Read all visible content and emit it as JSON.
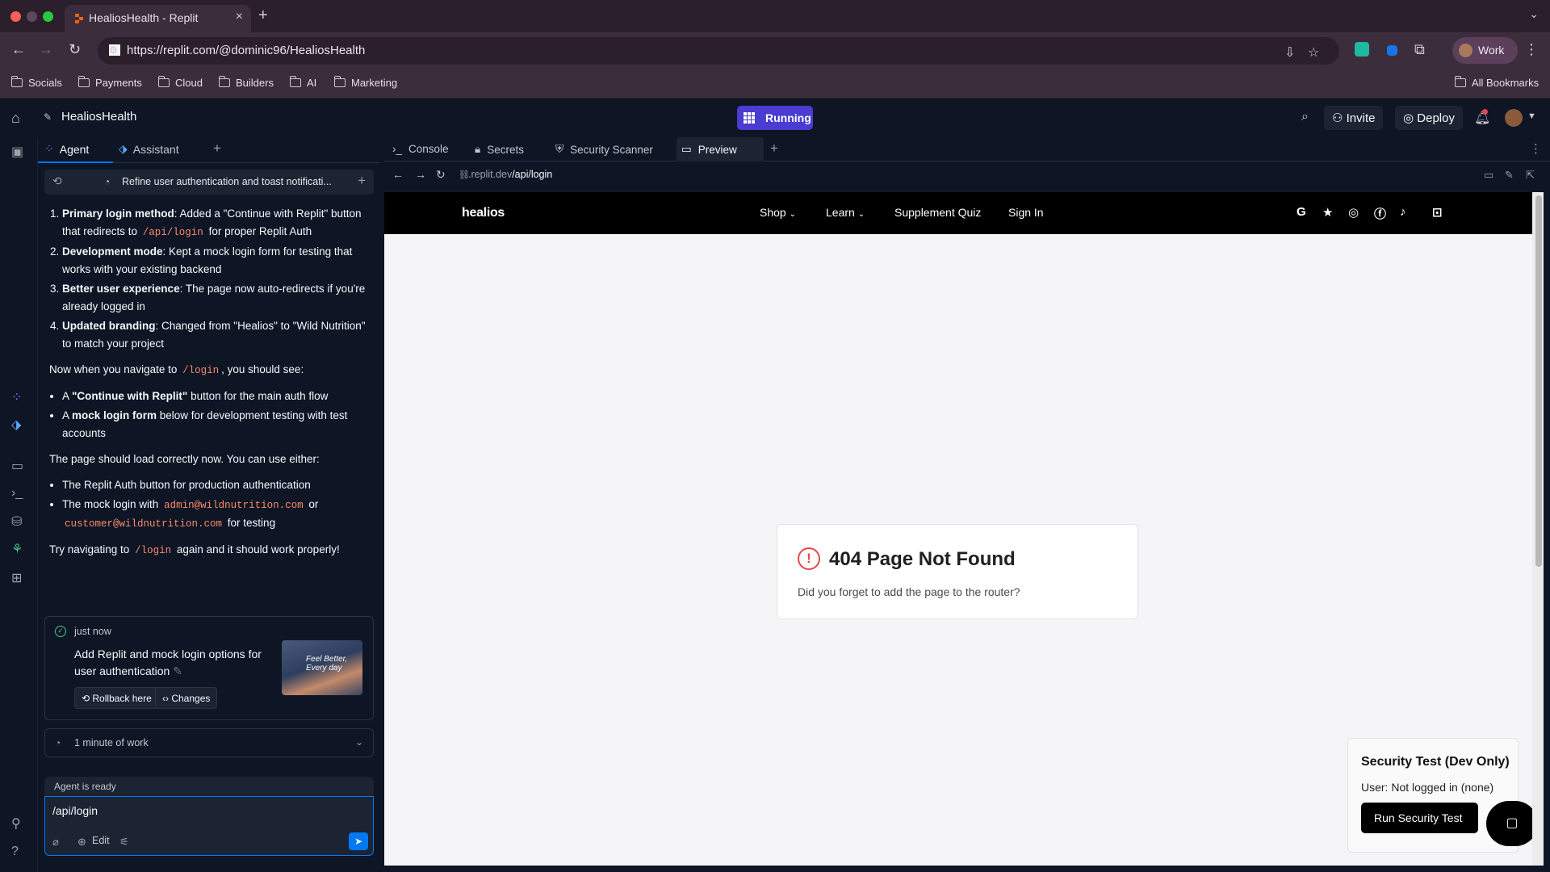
{
  "browser": {
    "tab_title": "HealiosHealth - Replit",
    "url": "https://replit.com/@dominic96/HealiosHealth",
    "profile_label": "Work",
    "bookmarks": [
      "Socials",
      "Payments",
      "Cloud",
      "Builders",
      "AI",
      "Marketing"
    ],
    "all_bookmarks": "All Bookmarks"
  },
  "workspace": {
    "project_name": "HealiosHealth",
    "run_status": "Running",
    "invite_label": "Invite",
    "deploy_label": "Deploy",
    "accent": "#4a3bd1"
  },
  "agent_panel": {
    "tabs": [
      {
        "label": "Agent"
      },
      {
        "label": "Assistant"
      }
    ],
    "thread_title": "Refine user authentication and toast notificati...",
    "message": {
      "numbered": [
        {
          "bold": "Primary login method",
          "pre": ": Added a \"Continue with Replit\" button that redirects to ",
          "code": "/api/login",
          "post": " for proper Replit Auth"
        },
        {
          "bold": "Development mode",
          "text": ": Kept a mock login form for testing that works with your existing backend"
        },
        {
          "bold": "Better user experience",
          "text": ": The page now auto-redirects if you're already logged in"
        },
        {
          "bold": "Updated branding",
          "text": ": Changed from \"Healios\" to \"Wild Nutrition\" to match your project"
        }
      ],
      "navigate_pre": "Now when you navigate to ",
      "navigate_code": "/login",
      "navigate_post": ", you should see:",
      "bullets1": [
        {
          "pre": "A ",
          "bold": "\"Continue with Replit\"",
          "post": " button for the main auth flow"
        },
        {
          "pre": "A ",
          "bold": "mock login form",
          "post": " below for development testing with test accounts"
        }
      ],
      "either": "The page should load correctly now. You can use either:",
      "bullets2_a": "The Replit Auth button for production authentication",
      "bullets2_b_pre": "The mock login with ",
      "bullets2_b_code1": "admin@wildnutrition.com",
      "bullets2_b_mid": " or ",
      "bullets2_b_code2": "customer@wildnutrition.com",
      "bullets2_b_post": " for testing",
      "final_pre": "Try navigating to ",
      "final_code": "/login",
      "final_post": " again and it should work properly!"
    },
    "checkpoint": {
      "time": "just now",
      "description": "Add Replit and mock login options for user authentication",
      "thumb_text": "Feel Better, Every day",
      "rollback_label": "Rollback here",
      "changes_label": "Changes"
    },
    "work_time": "1 minute of work",
    "status": "Agent is ready",
    "input_value": "/api/login",
    "edit_label": "Edit"
  },
  "preview_pane": {
    "tabs": [
      {
        "label": "Console"
      },
      {
        "label": "Secrets"
      },
      {
        "label": "Security Scanner"
      },
      {
        "label": "Preview"
      }
    ],
    "url_host": ".replit.dev",
    "url_path": "/api/login"
  },
  "site": {
    "logo": "healios",
    "nav": [
      "Shop",
      "Learn",
      "Supplement Quiz",
      "Sign In"
    ],
    "error_title": "404 Page Not Found",
    "error_text": "Did you forget to add the page to the router?",
    "security_title": "Security Test (Dev Only)",
    "security_user": "User: Not logged in (none)",
    "security_button": "Run Security Test"
  }
}
